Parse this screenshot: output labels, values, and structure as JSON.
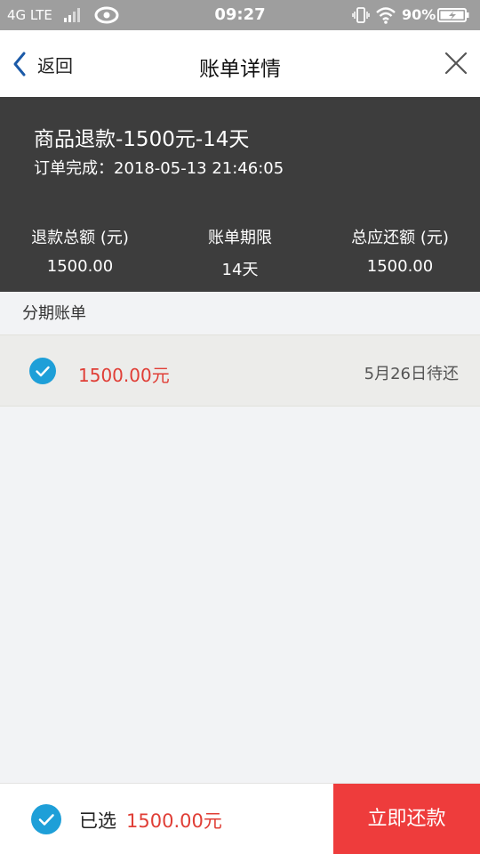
{
  "status_bar": {
    "network": "4G LTE",
    "time": "09:27",
    "battery": "90%"
  },
  "nav": {
    "back_label": "返回",
    "title": "账单详情"
  },
  "summary": {
    "title": "商品退款-1500元-14天",
    "order_status": "订单完成：2018-05-13 21:46:05",
    "stats": [
      {
        "label": "退款总额 (元)",
        "value": "1500.00"
      },
      {
        "label": "账单期限",
        "value": "14天"
      },
      {
        "label": "总应还额 (元)",
        "value": "1500.00"
      }
    ]
  },
  "installments": {
    "section_label": "分期账单",
    "items": [
      {
        "amount": "1500.00元",
        "due": "5月26日待还",
        "checked": true
      }
    ]
  },
  "footer": {
    "selected_label": "已选",
    "selected_amount": "1500.00元",
    "pay_label": "立即还款"
  },
  "colors": {
    "accent_blue": "#1e9fd8",
    "amount_red": "#e03e36",
    "button_red": "#ee3c3c",
    "header_dark": "#3d3d3d"
  }
}
